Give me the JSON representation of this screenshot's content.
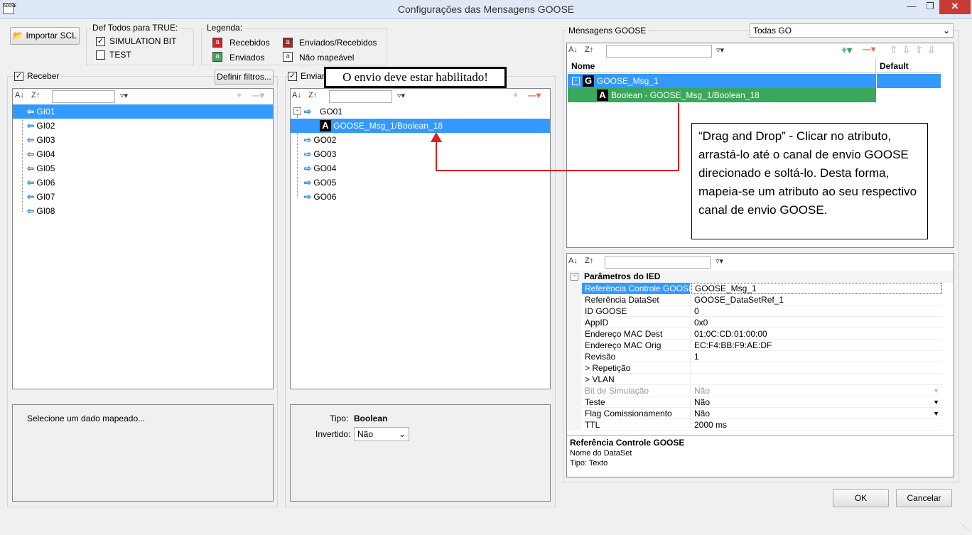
{
  "window": {
    "title": "Configurações das Mensagens GOOSE",
    "icon_text": "GOOSE"
  },
  "toolbar": {
    "import_label": "Importar SCL"
  },
  "def_true": {
    "title": "Def Todos para TRUE:",
    "simulation_label": "SIMULATION BIT",
    "test_label": "TEST"
  },
  "legend": {
    "title": "Legenda:",
    "received": "Recebidos",
    "sent_received": "Enviados/Recebidos",
    "sent": "Enviados",
    "unmapped": "Não mapeável",
    "colors": {
      "received": "#d9201e",
      "sent_received": "#9c2b2e",
      "sent": "#3aa75a",
      "unmapped": "#ffffff"
    }
  },
  "receive": {
    "label": "Receber",
    "filter_button": "Definir filtros...",
    "items": [
      "GI01",
      "GI02",
      "GI03",
      "GI04",
      "GI05",
      "GI06",
      "GI07",
      "GI08"
    ],
    "info_text": "Selecione um dado mapeado..."
  },
  "send": {
    "label": "Enviar",
    "callout": "O envio deve estar habilitado!",
    "go01": "GO01",
    "go01_child": "GOOSE_Msg_1/Boolean_18",
    "items": [
      "GO02",
      "GO03",
      "GO04",
      "GO05",
      "GO06"
    ],
    "tipo_label": "Tipo:",
    "tipo_value": "Boolean",
    "invertido_label": "Invertido:",
    "invertido_value": "Não"
  },
  "goose": {
    "group_label": "Mensagens GOOSE",
    "filter_value": "Todas GO",
    "col_nome": "Nome",
    "col_default": "Default",
    "msg": "GOOSE_Msg_1",
    "attribute": "Boolean - GOOSE_Msg_1/Boolean_18",
    "drag_callout": "“Drag and Drop” - Clicar no atributo, arrastá-lo até o canal de envio GOOSE direcionado  e soltá-lo. Desta forma, mapeia-se um atributo ao seu respectivo canal de envio GOOSE."
  },
  "params": {
    "section": "Parâmetros do IED",
    "rows": [
      {
        "name": "Referência Controle GOOSE",
        "value": "GOOSE_Msg_1"
      },
      {
        "name": "Referência DataSet",
        "value": "GOOSE_DataSetRef_1"
      },
      {
        "name": "ID GOOSE",
        "value": "0"
      },
      {
        "name": "AppID",
        "value": "0x0"
      },
      {
        "name": "Endereço MAC Dest",
        "value": "01:0C:CD:01:00:00"
      },
      {
        "name": "Endereço MAC Orig",
        "value": "EC:F4:BB:F9:AE:DF"
      },
      {
        "name": "Revisão",
        "value": "1"
      },
      {
        "name": "> Repetição",
        "value": ""
      },
      {
        "name": "> VLAN",
        "value": ""
      },
      {
        "name": "Bit de Simulação",
        "value": "Não"
      },
      {
        "name": "Teste",
        "value": "Não"
      },
      {
        "name": "Flag Comissionamento",
        "value": "Não"
      },
      {
        "name": "TTL",
        "value": "2000 ms"
      }
    ],
    "desc_title": "Referência Controle GOOSE",
    "desc_line1": "Nome do DataSet",
    "desc_line2": "Tipo: Texto"
  },
  "footer": {
    "ok": "OK",
    "cancel": "Cancelar"
  },
  "colors": {
    "selection": "#3399ff",
    "green": "#3aa75a",
    "arrow": "#e02020"
  }
}
